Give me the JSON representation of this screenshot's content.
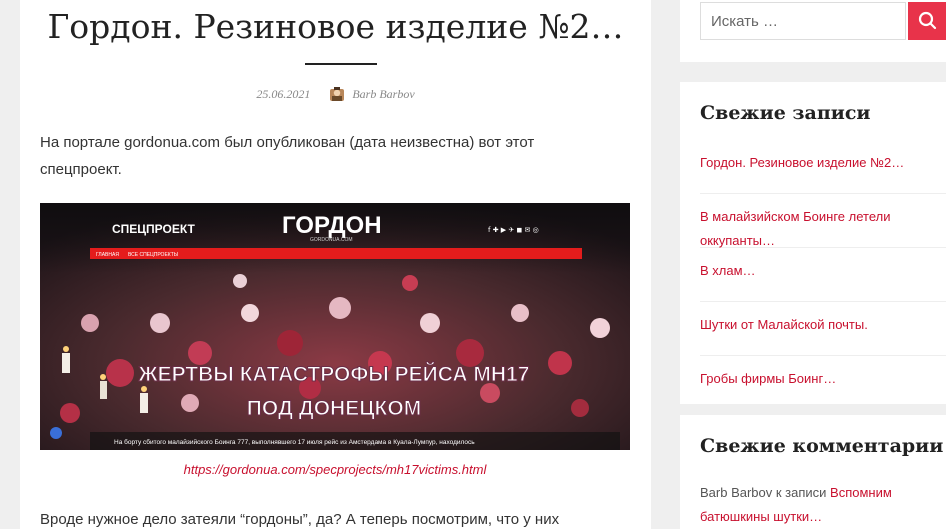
{
  "article": {
    "title": "Гордон. Резиновое изделие №2…",
    "date": "25.06.2021",
    "author": "Barb Barbov",
    "paragraph1": "На портале gordonua.com был опубликован (дата неизвестна) вот этот спецпроект.",
    "paragraph2": "Вроде нужное дело затеяли “гордоны”, да? А теперь посмотрим, что у них",
    "caption": "https://gordonua.com/specprojects/mh17victims.html",
    "image": {
      "spec_label": "СПЕЦПРОЕКТ",
      "logo": "ГОРДОН",
      "logo_sub": "GORDONUA.COM",
      "nav_home": "ГЛАВНАЯ",
      "nav_all": "ВСЕ СПЕЦПРОЕКТЫ",
      "headline1": "ЖЕРТВЫ КАТАСТРОФЫ РЕЙСА МН17",
      "headline2": "ПОД ДОНЕЦКОМ",
      "bottom_text": "На борту сбитого малайзийского Боинга 777, выполнявшего 17 июля рейс из Амстердама в Куала-Лумпур, находилось",
      "social_icons": "f ✚ ▶ ✈ ◼ ✉ ◎"
    }
  },
  "sidebar": {
    "search": {
      "placeholder": "Искать …"
    },
    "recent_posts": {
      "title": "Свежие записи",
      "items": [
        {
          "label": "Гордон. Резиновое изделие №2…"
        },
        {
          "label": "В малайзийском Боинге летели оккупанты…"
        },
        {
          "label": "В хлам…"
        },
        {
          "label": "Шутки от Малайской почты."
        },
        {
          "label": "Гробы фирмы Боинг…"
        }
      ]
    },
    "recent_comments": {
      "title": "Свежие комментарии",
      "author": "Barb Barbov",
      "connector": " к записи ",
      "post": "Вспомним батюшкины шутки…"
    }
  },
  "colors": {
    "accent": "#c8102e",
    "search_button": "#e8334a"
  }
}
